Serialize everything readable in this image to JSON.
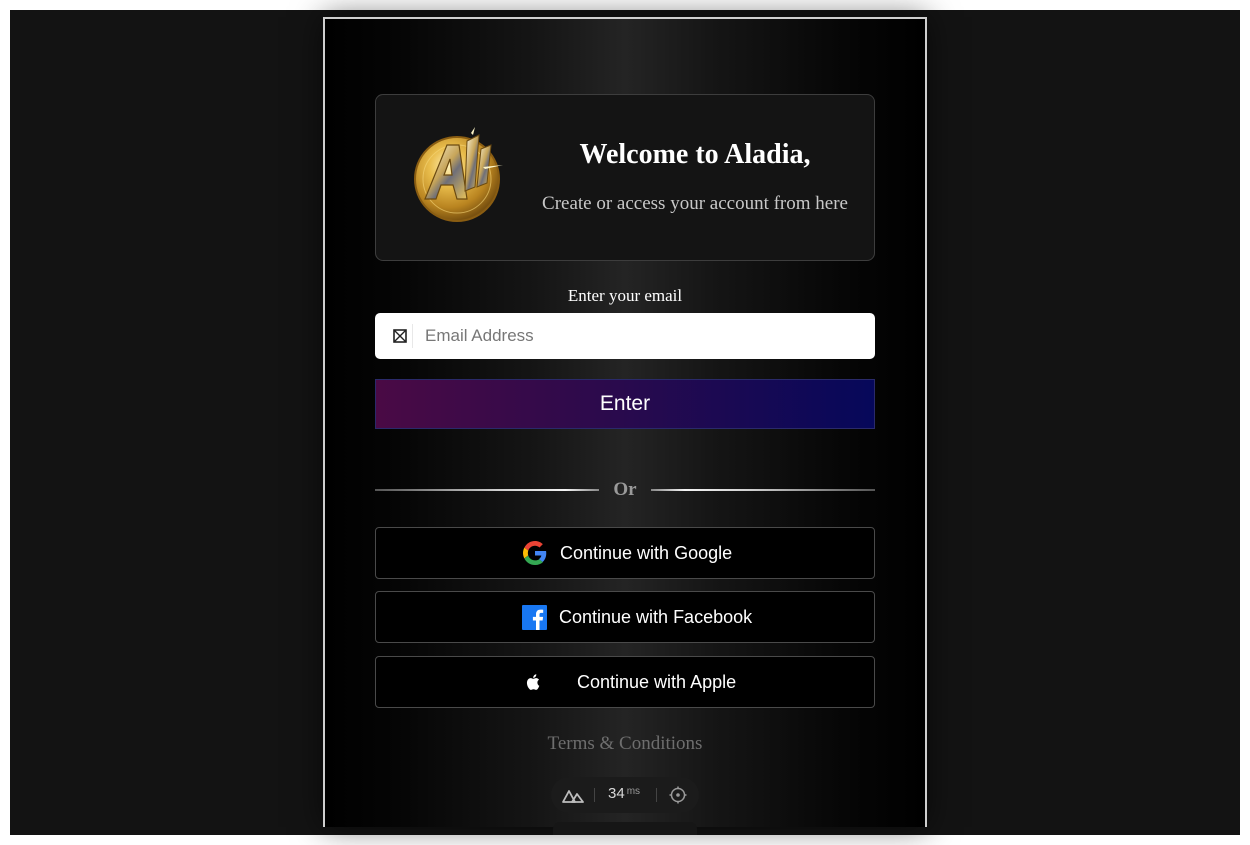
{
  "welcome": {
    "title": "Welcome to Aladia,",
    "subtitle": "Create or access your account from here",
    "logo_icon": "aladia-gold-coin-logo"
  },
  "email": {
    "label": "Enter your email",
    "placeholder": "Email Address",
    "value": "",
    "icon": "mail-icon"
  },
  "enter_button": {
    "label": "Enter"
  },
  "divider": {
    "text": "Or"
  },
  "social": {
    "google": {
      "label": "Continue with Google",
      "icon": "google-icon"
    },
    "facebook": {
      "label": "Continue with Facebook",
      "icon": "facebook-icon"
    },
    "apple": {
      "label": "Continue with Apple",
      "icon": "apple-icon"
    }
  },
  "terms": {
    "label": "Terms & Conditions"
  },
  "devtools": {
    "icon": "nuxt-logo-icon",
    "response_time": "34",
    "unit": "ms",
    "inspect_icon": "crosshair-icon"
  },
  "colors": {
    "page_background": "#131313",
    "enter_gradient_start": "#4a0a45",
    "enter_gradient_end": "#06085a",
    "card_border": "#3d3d3d",
    "gold": "#d4a537"
  }
}
